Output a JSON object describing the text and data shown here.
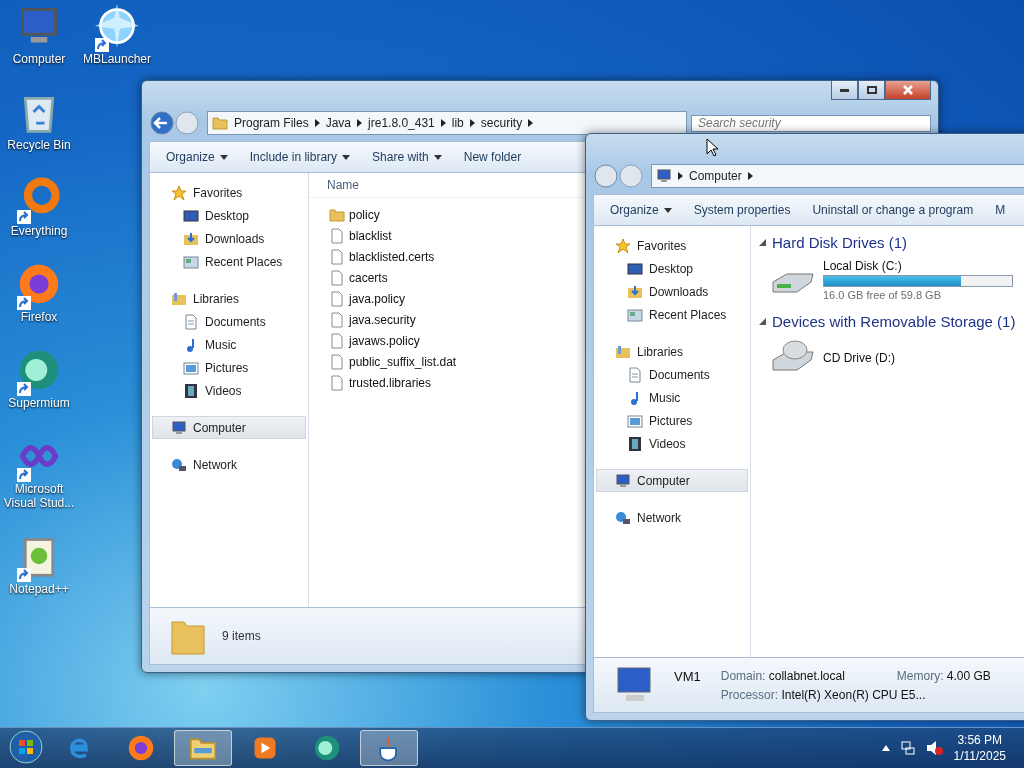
{
  "desktop_icons": [
    {
      "label": "Computer",
      "kind": "computer",
      "shortcut": false
    },
    {
      "label": "MBLauncher",
      "kind": "globe",
      "shortcut": true
    },
    {
      "label": "Recycle Bin",
      "kind": "bin",
      "shortcut": false
    },
    {
      "label": "Everything",
      "kind": "ring",
      "shortcut": true
    },
    {
      "label": "Firefox",
      "kind": "firefox",
      "shortcut": true
    },
    {
      "label": "Supermium",
      "kind": "supermium",
      "shortcut": true
    },
    {
      "label": "Microsoft Visual Stud...",
      "kind": "vs",
      "shortcut": true
    },
    {
      "label": "Notepad++",
      "kind": "notepad",
      "shortcut": true
    }
  ],
  "security_window": {
    "address": [
      "Program Files",
      "Java",
      "jre1.8.0_431",
      "lib",
      "security"
    ],
    "search": {
      "placeholder": "Search security"
    },
    "toolbar": [
      {
        "label": "Organize",
        "dropdown": true
      },
      {
        "label": "Include in library",
        "dropdown": true
      },
      {
        "label": "Share with",
        "dropdown": true
      },
      {
        "label": "New folder",
        "dropdown": false
      }
    ],
    "nav": [
      {
        "label": "Favorites",
        "kind": "star",
        "selected": false,
        "children": [
          {
            "label": "Desktop",
            "kind": "desktop",
            "selected": false
          },
          {
            "label": "Downloads",
            "kind": "downloads",
            "selected": false
          },
          {
            "label": "Recent Places",
            "kind": "recent",
            "selected": false
          }
        ]
      },
      {
        "label": "Libraries",
        "kind": "library",
        "selected": false,
        "children": [
          {
            "label": "Documents",
            "kind": "doc",
            "selected": false
          },
          {
            "label": "Music",
            "kind": "music",
            "selected": false
          },
          {
            "label": "Pictures",
            "kind": "pictures",
            "selected": false
          },
          {
            "label": "Videos",
            "kind": "videos",
            "selected": false
          }
        ]
      },
      {
        "label": "Computer",
        "kind": "computer",
        "selected": true
      },
      {
        "label": "Network",
        "kind": "network",
        "selected": false
      }
    ],
    "column": "Name",
    "files": [
      {
        "name": "policy",
        "kind": "folder"
      },
      {
        "name": "blacklist",
        "kind": "file"
      },
      {
        "name": "blacklisted.certs",
        "kind": "file"
      },
      {
        "name": "cacerts",
        "kind": "file"
      },
      {
        "name": "java.policy",
        "kind": "file"
      },
      {
        "name": "java.security",
        "kind": "file"
      },
      {
        "name": "javaws.policy",
        "kind": "file"
      },
      {
        "name": "public_suffix_list.dat",
        "kind": "file"
      },
      {
        "name": "trusted.libraries",
        "kind": "file"
      }
    ],
    "status": "9 items"
  },
  "computer_window": {
    "address": [
      "Computer"
    ],
    "toolbar": [
      {
        "label": "Organize",
        "dropdown": true
      },
      {
        "label": "System properties",
        "dropdown": false
      },
      {
        "label": "Uninstall or change a program",
        "dropdown": false
      },
      {
        "label": "M",
        "dropdown": false
      }
    ],
    "nav": [
      {
        "label": "Favorites",
        "kind": "star",
        "selected": false,
        "children": [
          {
            "label": "Desktop",
            "kind": "desktop",
            "selected": false
          },
          {
            "label": "Downloads",
            "kind": "downloads",
            "selected": false
          },
          {
            "label": "Recent Places",
            "kind": "recent",
            "selected": false
          }
        ]
      },
      {
        "label": "Libraries",
        "kind": "library",
        "selected": false,
        "children": [
          {
            "label": "Documents",
            "kind": "doc",
            "selected": false
          },
          {
            "label": "Music",
            "kind": "music",
            "selected": false
          },
          {
            "label": "Pictures",
            "kind": "pictures",
            "selected": false
          },
          {
            "label": "Videos",
            "kind": "videos",
            "selected": false
          }
        ]
      },
      {
        "label": "Computer",
        "kind": "computer",
        "selected": true
      },
      {
        "label": "Network",
        "kind": "network",
        "selected": false
      }
    ],
    "groups": [
      {
        "title": "Hard Disk Drives (1)",
        "drives": [
          {
            "name": "Local Disk (C:)",
            "kind": "disk",
            "level": 0.73,
            "free": "16.0 GB free of 59.8 GB"
          }
        ]
      },
      {
        "title": "Devices with Removable Storage (1)",
        "drives": [
          {
            "name": "CD Drive (D:)",
            "kind": "cd"
          }
        ]
      }
    ],
    "details": {
      "name": "VM1",
      "domain_label": "Domain:",
      "domain": "collabnet.local",
      "memory_label": "Memory:",
      "memory": "4.00 GB",
      "processor_label": "Processor:",
      "processor": "Intel(R) Xeon(R) CPU E5..."
    }
  },
  "taskbar": {
    "apps": [
      {
        "kind": "ie",
        "active": false
      },
      {
        "kind": "firefox",
        "active": false
      },
      {
        "kind": "explorer",
        "active": true
      },
      {
        "kind": "media",
        "active": false
      },
      {
        "kind": "supermium",
        "active": false
      },
      {
        "kind": "java",
        "active": true
      }
    ],
    "time": "3:56 PM",
    "date": "1/11/2025"
  }
}
